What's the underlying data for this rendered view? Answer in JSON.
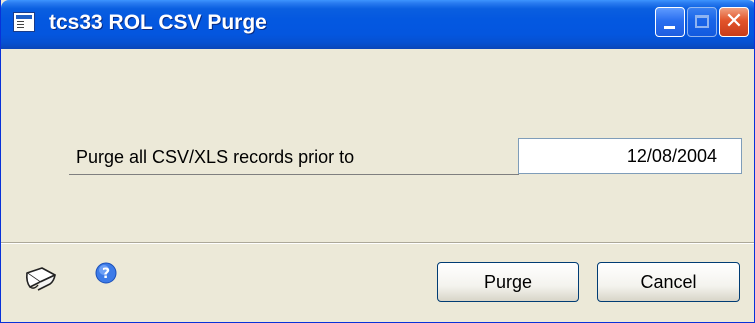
{
  "window": {
    "title": "tcs33 ROL CSV Purge"
  },
  "form": {
    "purge_label": "Purge all CSV/XLS records prior to",
    "purge_date": "12/08/2004"
  },
  "footer": {
    "purge_button": "Purge",
    "cancel_button": "Cancel"
  },
  "icons": {
    "app": "window-form-icon",
    "note": "note-icon",
    "help": "help-icon"
  },
  "colors": {
    "titlebar": "#0458e0",
    "window_bg": "#ece9d8",
    "close": "#e2542a"
  }
}
